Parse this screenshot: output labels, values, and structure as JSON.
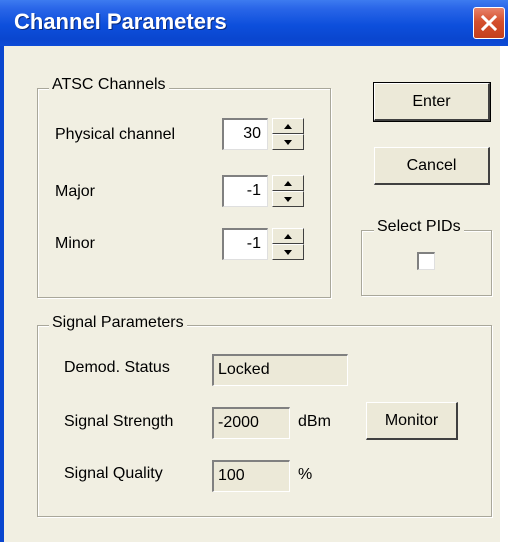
{
  "window": {
    "title": "Channel Parameters"
  },
  "atsc": {
    "group_label": "ATSC Channels",
    "physical": {
      "label": "Physical channel",
      "value": "30"
    },
    "major": {
      "label": "Major",
      "value": "-1"
    },
    "minor": {
      "label": "Minor",
      "value": "-1"
    }
  },
  "buttons": {
    "enter": "Enter",
    "cancel": "Cancel",
    "monitor": "Monitor"
  },
  "select_pids": {
    "label": "Select PIDs",
    "checked": false
  },
  "signal": {
    "group_label": "Signal Parameters",
    "demod": {
      "label": "Demod. Status",
      "value": "Locked"
    },
    "strength": {
      "label": "Signal Strength",
      "value": "-2000",
      "unit": "dBm"
    },
    "quality": {
      "label": "Signal Quality",
      "value": "100",
      "unit": "%"
    }
  },
  "colors": {
    "titlebar": "#0a46cf",
    "face": "#f1efe2",
    "close": "#d4502e"
  }
}
